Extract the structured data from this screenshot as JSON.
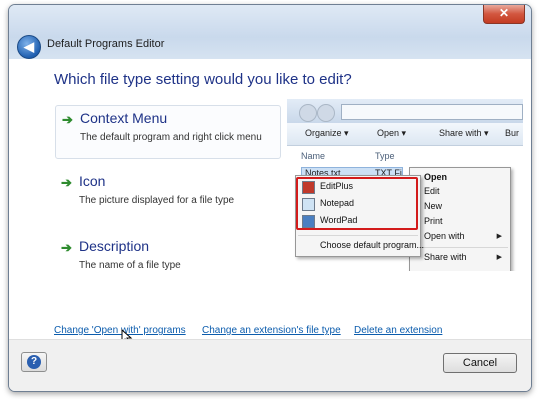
{
  "window": {
    "title": "Default Programs Editor",
    "close_icon": "close-icon",
    "back_icon": "back-arrow-icon"
  },
  "main": {
    "question": "Which file type setting would you like to edit?",
    "options": [
      {
        "title": "Context Menu",
        "description": "The default program and right click menu",
        "icon": "green-arrow-icon"
      },
      {
        "title": "Icon",
        "description": "The picture displayed for a file type",
        "icon": "green-arrow-icon"
      },
      {
        "title": "Description",
        "description": "The name of a file type",
        "icon": "green-arrow-icon"
      }
    ],
    "links": [
      "Change 'Open with' programs",
      "Change an extension's file type",
      "Delete an extension"
    ]
  },
  "preview": {
    "toolbar": [
      "Organize ▾",
      "Open ▾",
      "Share with ▾",
      "Bur"
    ],
    "columns": [
      "Name",
      "Type"
    ],
    "file": {
      "name": "Notes.txt",
      "type": "TXT Fi"
    },
    "context_menu": [
      {
        "label": "Open",
        "bold": true
      },
      {
        "label": "Edit"
      },
      {
        "label": "New"
      },
      {
        "label": "Print"
      },
      {
        "label": "Open with",
        "submenu": true
      },
      {
        "label": "Share with",
        "submenu": true
      }
    ],
    "open_with": [
      {
        "label": "EditPlus",
        "icon": "editplus-icon"
      },
      {
        "label": "Notepad",
        "icon": "notepad-icon"
      },
      {
        "label": "WordPad",
        "icon": "wordpad-icon"
      }
    ],
    "choose_default": "Choose default program..."
  },
  "footer": {
    "help_label": "?",
    "cancel_label": "Cancel"
  },
  "colors": {
    "heading": "#1e3287",
    "link": "#0b5cad",
    "accent_green": "#2e8b2e",
    "highlight_red": "#d31b1b"
  }
}
